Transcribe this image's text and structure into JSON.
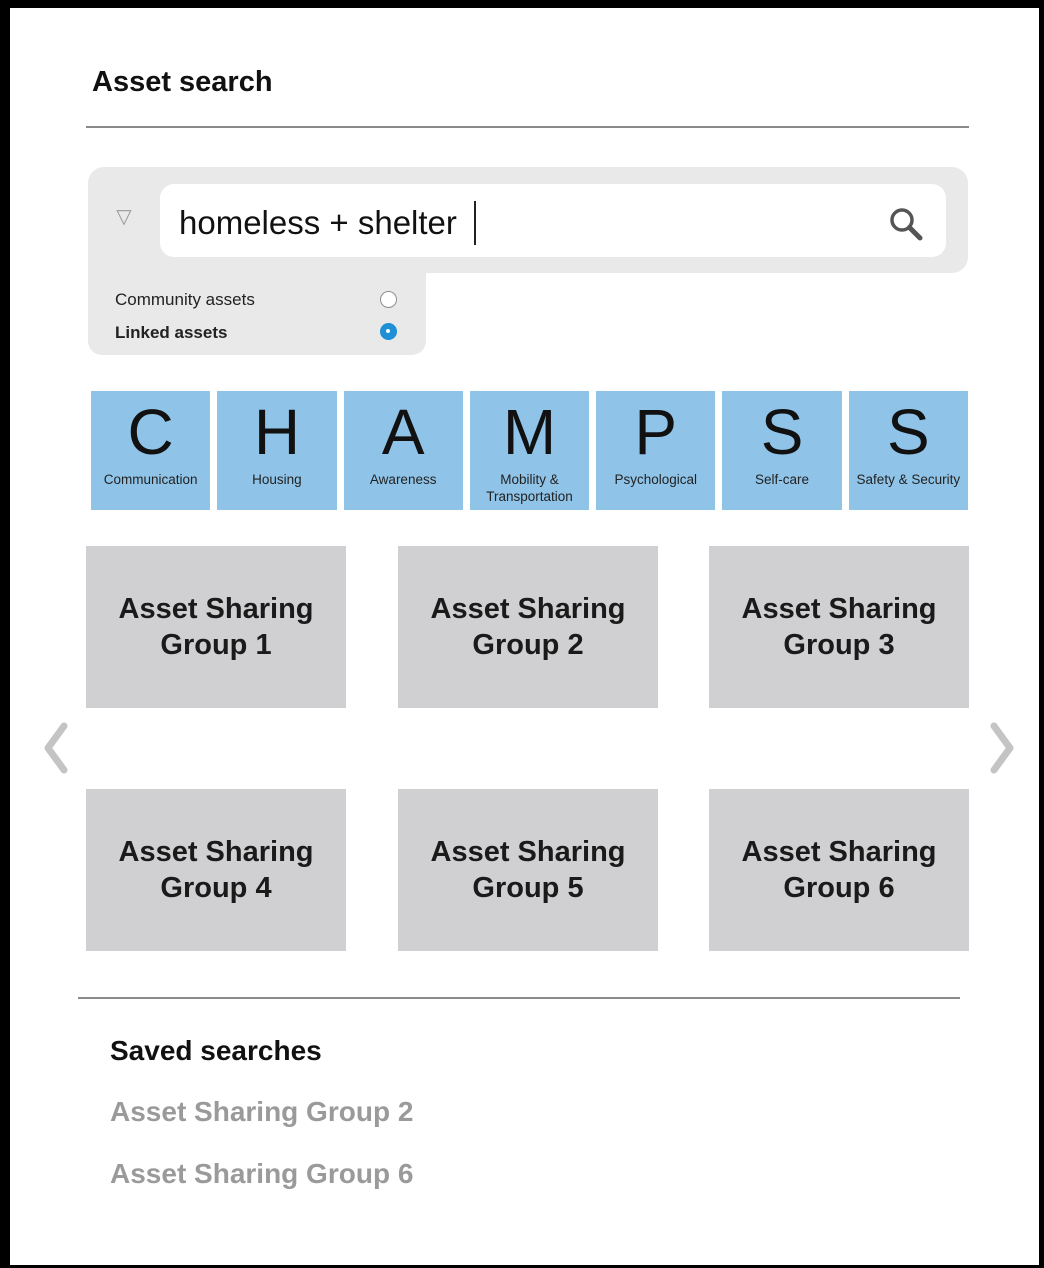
{
  "header": {
    "title": "Asset search"
  },
  "search": {
    "query": "homeless + shelter"
  },
  "filters": [
    {
      "label": "Community assets",
      "selected": false
    },
    {
      "label": "Linked assets",
      "selected": true
    }
  ],
  "champs": [
    {
      "letter": "C",
      "label": "Communication"
    },
    {
      "letter": "H",
      "label": "Housing"
    },
    {
      "letter": "A",
      "label": "Awareness"
    },
    {
      "letter": "M",
      "label": "Mobility & Transportation"
    },
    {
      "letter": "P",
      "label": "Psychological"
    },
    {
      "letter": "S",
      "label": "Self-care"
    },
    {
      "letter": "S",
      "label": "Safety & Security"
    }
  ],
  "groups": [
    {
      "label": "Asset Sharing Group 1"
    },
    {
      "label": "Asset Sharing Group 2"
    },
    {
      "label": "Asset Sharing Group 3"
    },
    {
      "label": "Asset Sharing Group 4"
    },
    {
      "label": "Asset Sharing Group 5"
    },
    {
      "label": "Asset Sharing Group 6"
    }
  ],
  "saved": {
    "heading": "Saved searches",
    "items": [
      {
        "label": "Asset Sharing Group 2"
      },
      {
        "label": "Asset Sharing Group 6"
      }
    ]
  },
  "colors": {
    "champ_tile": "#8fc4e8",
    "group_tile": "#d0d0d2",
    "radio_selected": "#1f8fd6",
    "saved_item_text": "#9a9a9a"
  }
}
